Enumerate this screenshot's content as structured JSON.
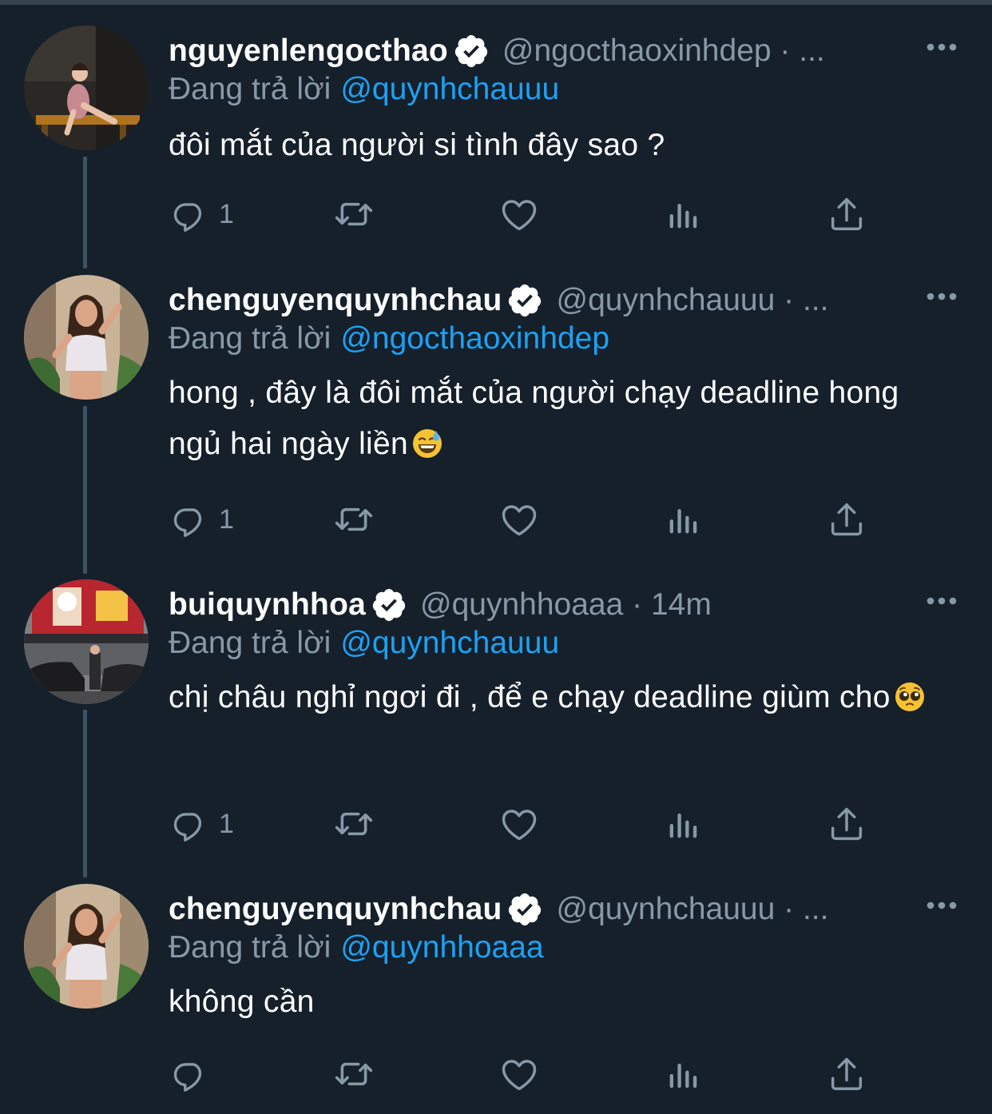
{
  "colors": {
    "background": "#15202b",
    "text_primary": "#ffffff",
    "text_secondary": "#8899a6",
    "accent": "#1da1f2",
    "thread_line": "#3d5466"
  },
  "reply_prefix": "Đang trả lời",
  "tweets": [
    {
      "name": "nguyenlengocthao",
      "verified": true,
      "handle": "@ngocthaoxinhdep · ...",
      "reply_to": "@quynhchauuu",
      "text": "đôi mắt của người si tình đây sao ?",
      "reply_count": "1",
      "emoji": ""
    },
    {
      "name": "chenguyenquynhchau",
      "verified": true,
      "handle": "@quynhchauuu · ...",
      "reply_to": "@ngocthaoxinhdep",
      "text": "hong , đây là đôi mắt của người chạy deadline hong ngủ hai ngày liền",
      "reply_count": "1",
      "emoji": "grinning-face-with-sweat"
    },
    {
      "name": "buiquynhhoa",
      "verified": true,
      "handle": "@quynhhoaaa · 14m",
      "reply_to": "@quynhchauuu",
      "text": "chị châu nghỉ ngơi đi , để e chạy deadline giùm cho",
      "reply_count": "1",
      "emoji": "pleading-face"
    },
    {
      "name": "chenguyenquynhchau",
      "verified": true,
      "handle": "@quynhchauuu · ...",
      "reply_to": "@quynhhoaaa",
      "text": "không cần",
      "reply_count": "",
      "emoji": ""
    }
  ],
  "icons": [
    "reply-icon",
    "retweet-icon",
    "like-icon",
    "analytics-icon",
    "share-icon",
    "more-icon",
    "verified-badge-icon"
  ]
}
